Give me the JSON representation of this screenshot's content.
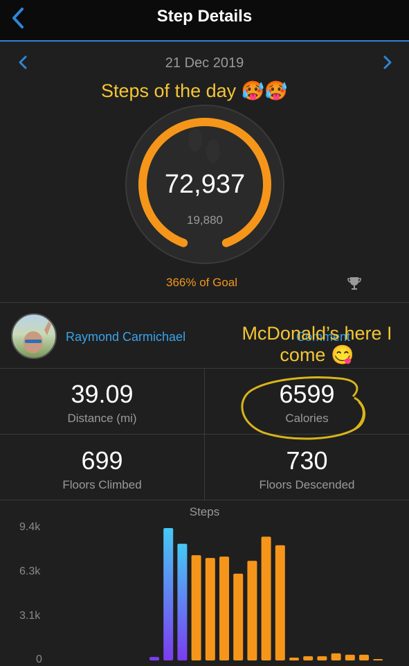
{
  "header": {
    "title": "Step Details"
  },
  "date_nav": {
    "date": "21 Dec 2019"
  },
  "overlay_text": {
    "steps_of_day": "Steps of the day 🥵🥵",
    "mcdonalds": "McDonald’s here I come 😋"
  },
  "ring": {
    "steps": "72,937",
    "goal": "19,880",
    "goal_percent_text": "366% of Goal",
    "fraction": 1.0,
    "color": "#f5961b"
  },
  "social": {
    "user_name": "Raymond Carmichael",
    "comment_label": "Comment"
  },
  "stats": [
    {
      "value": "39.09",
      "label": "Distance (mi)"
    },
    {
      "value": "6599",
      "label": "Calories"
    },
    {
      "value": "699",
      "label": "Floors Climbed"
    },
    {
      "value": "730",
      "label": "Floors Descended"
    }
  ],
  "chart_data": {
    "type": "bar",
    "title": "Steps",
    "yticks": [
      "9.4k",
      "6.3k",
      "3.1k",
      "0"
    ],
    "ylim": [
      0,
      9400
    ],
    "values": [
      250,
      9300,
      8200,
      7400,
      7200,
      7300,
      6100,
      7000,
      8700,
      8100,
      200,
      300,
      300,
      500,
      400,
      400,
      100
    ],
    "colors": [
      "#7b3cf0",
      "#46c8f5",
      "#3aa8f0",
      "#f5961b",
      "#f5961b",
      "#f5961b",
      "#f5961b",
      "#f5961b",
      "#f5961b",
      "#f5961b",
      "#f5961b",
      "#f5961b",
      "#f5961b",
      "#f5961b",
      "#f5961b",
      "#f5961b",
      "#f5961b"
    ]
  },
  "colors": {
    "accent_blue": "#2e86d6",
    "orange": "#f5961b",
    "annotation_yellow": "#f3c634"
  },
  "icons": {
    "back": "chevron-left-icon",
    "prev": "chevron-left-icon",
    "next": "chevron-right-icon",
    "trophy": "trophy-icon"
  }
}
